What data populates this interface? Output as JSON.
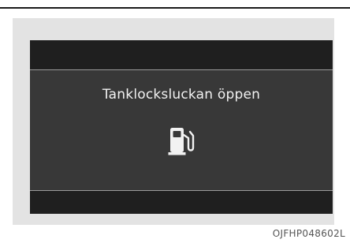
{
  "display": {
    "message": "Tanklocksluckan öppen",
    "icon": "fuel-pump-icon"
  },
  "caption": "OJFHP048602L",
  "colors": {
    "screen": "#383838",
    "bars": "#1f1f1f",
    "text": "#f2f2f2",
    "panel": "#e3e3e3"
  }
}
